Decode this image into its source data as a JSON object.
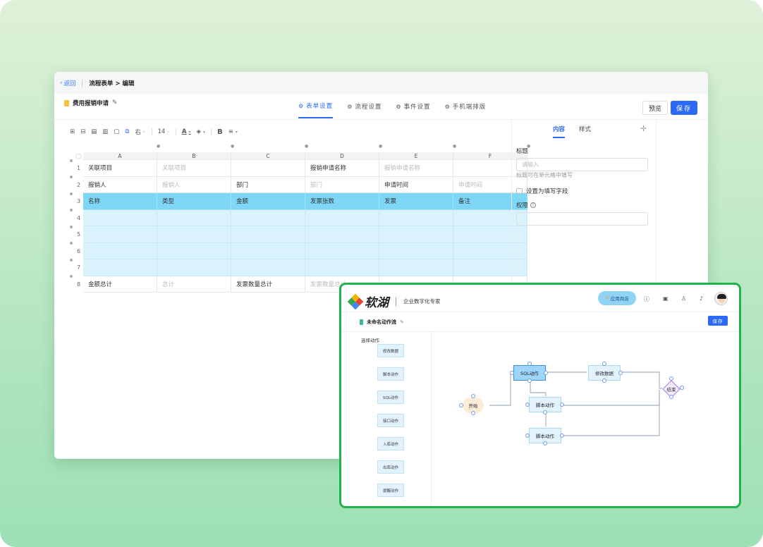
{
  "editor": {
    "back_label": "返回",
    "breadcrumb": "流程表单 > 编辑",
    "doc_title": "费用报销申请",
    "tabs": [
      {
        "label": "表单设置",
        "icon": "gear-icon"
      },
      {
        "label": "流程设置",
        "icon": "gear-icon"
      },
      {
        "label": "事件设置",
        "icon": "gear-icon"
      },
      {
        "label": "手机端排版",
        "icon": "gear-icon"
      }
    ],
    "preview_label": "预览",
    "save_label": "保存",
    "toolbar": {
      "align_label": "右",
      "font_size": "14",
      "bold_label": "B",
      "font_color_label": "A"
    },
    "grid": {
      "columns": [
        "A",
        "B",
        "C",
        "D",
        "E",
        "F"
      ],
      "rows": [
        {
          "n": "1",
          "cells": [
            "关联项目",
            "关联项目",
            "",
            "报销申请名称",
            "报销申请名称",
            ""
          ]
        },
        {
          "n": "2",
          "cells": [
            "报销人",
            "报销人",
            "部门",
            "部门",
            "申请时间",
            "申请时间"
          ]
        },
        {
          "n": "3",
          "cells": [
            "名称",
            "类型",
            "金额",
            "发票张数",
            "发票",
            "备注"
          ]
        },
        {
          "n": "4",
          "cells": [
            "",
            "",
            "",
            "",
            "",
            ""
          ]
        },
        {
          "n": "5",
          "cells": [
            "",
            "",
            "",
            "",
            "",
            ""
          ]
        },
        {
          "n": "6",
          "cells": [
            "",
            "",
            "",
            "",
            "",
            ""
          ]
        },
        {
          "n": "7",
          "cells": [
            "",
            "",
            "",
            "",
            "",
            ""
          ]
        },
        {
          "n": "8",
          "cells": [
            "金额总计",
            "总计",
            "发票数量总计",
            "发票数量总计",
            "",
            ""
          ]
        }
      ]
    },
    "panel": {
      "tab_content": "内容",
      "tab_style": "样式",
      "title_label": "标题",
      "title_placeholder": "请输入",
      "title_hint": "标题可在单元格中填写",
      "checkbox_label": "设置为填写字段",
      "permission_label": "权限"
    }
  },
  "workflow": {
    "brand_name": "软湖",
    "brand_tagline": "企业数字化专家",
    "app_store_label": "应用商店",
    "flow_name": "未命名动作流",
    "save_label": "保存",
    "pick_action_label": "选择动作",
    "actions": [
      "修改数据",
      "脚本动作",
      "SQL动作",
      "接口动作",
      "入库动作",
      "出库动作",
      "提醒动作"
    ],
    "nodes": {
      "start": "开始",
      "sql": "SQL动作",
      "modify": "修改数据",
      "script1": "脚本动作",
      "script2": "脚本动作",
      "end": "结束"
    },
    "colors": {
      "accent": "#2c6af5",
      "frame": "#22b24c"
    }
  }
}
